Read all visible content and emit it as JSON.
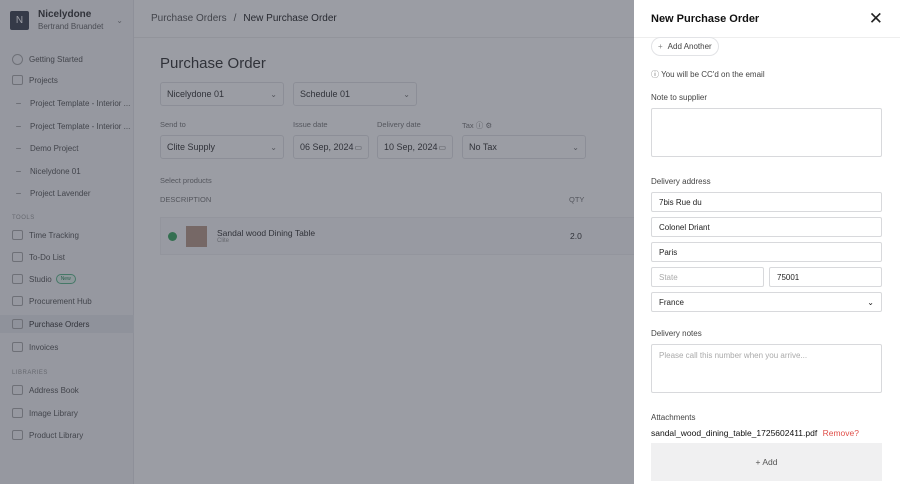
{
  "sidebar": {
    "workspace_initial": "N",
    "workspace_name": "Nicelydone",
    "user_name": "Bertrand Bruandet",
    "getting_started": "Getting Started",
    "projects": "Projects",
    "project_items": [
      "Project Template - Interior ...",
      "Project Template - Interior ...",
      "Demo Project",
      "Nicelydone 01",
      "Project Lavender"
    ],
    "tools_heading": "TOOLS",
    "tools": [
      "Time Tracking",
      "To-Do List",
      "Studio",
      "Procurement Hub",
      "Purchase Orders",
      "Invoices"
    ],
    "new_badge": "New",
    "libraries_heading": "LIBRARIES",
    "libraries": [
      "Address Book",
      "Image Library",
      "Product Library"
    ]
  },
  "breadcrumb": {
    "parent": "Purchase Orders",
    "sep": "/",
    "current": "New Purchase Order"
  },
  "form": {
    "title": "Purchase Order",
    "project": "Nicelydone 01",
    "schedule": "Schedule 01",
    "send_to_label": "Send to",
    "send_to": "Clite Supply",
    "issue_date_label": "Issue date",
    "issue_date": "06 Sep, 2024",
    "delivery_date_label": "Delivery date",
    "delivery_date": "10 Sep, 2024",
    "tax_label": "Tax",
    "tax": "No Tax",
    "select_products": "Select products",
    "col_description": "DESCRIPTION",
    "col_qty": "QTY",
    "product": {
      "name": "Sandal wood Dining Table",
      "supplier": "Clite",
      "qty": "2.0"
    }
  },
  "drawer": {
    "title": "New Purchase Order",
    "add_another": "Add Another",
    "cc_note": "You will be CC'd on the email",
    "note_label": "Note to supplier",
    "note_value": "",
    "address_label": "Delivery address",
    "address1": "7bis Rue du",
    "address2": "Colonel Driant",
    "city": "Paris",
    "state_placeholder": "State",
    "postcode": "75001",
    "country": "France",
    "delivery_notes_label": "Delivery notes",
    "delivery_notes_placeholder": "Please call this number when you arrive...",
    "attachments_label": "Attachments",
    "attachment_file": "sandal_wood_dining_table_1725602411.pdf",
    "remove": "Remove?",
    "add": "+ Add"
  }
}
